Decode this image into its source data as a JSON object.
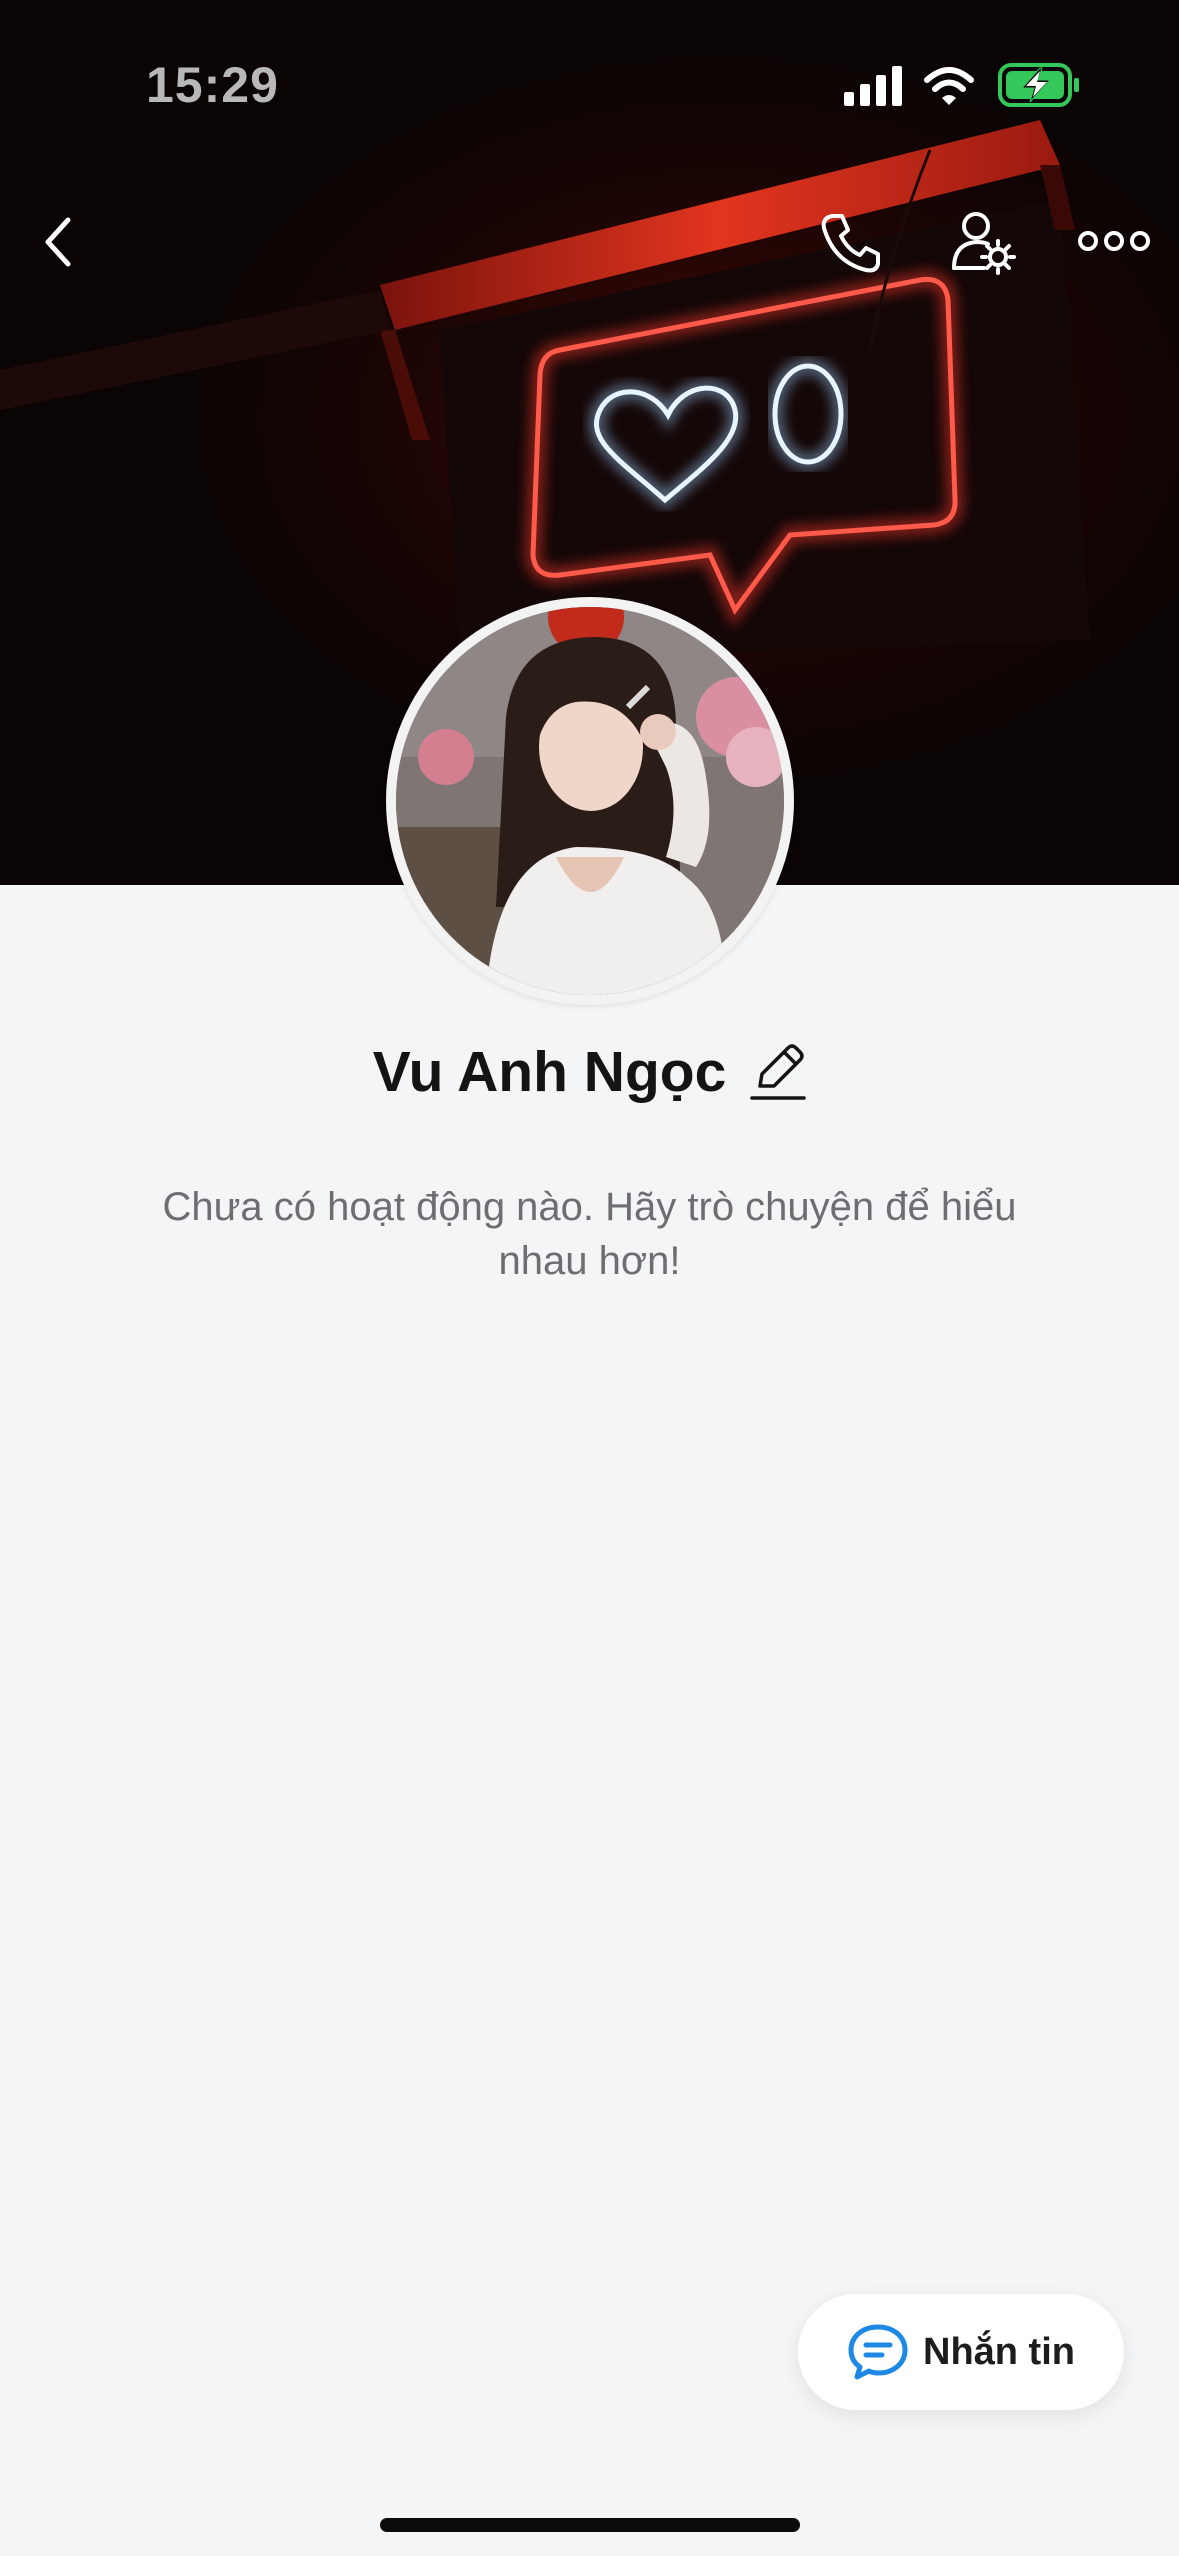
{
  "status_bar": {
    "time": "15:29",
    "icons": [
      "cellular-signal-icon",
      "wifi-icon",
      "battery-charging-icon"
    ]
  },
  "nav": {
    "back_icon": "chevron-left-icon",
    "call_icon": "phone-icon",
    "profile_settings_icon": "user-settings-icon",
    "more_icon": "more-dots-icon"
  },
  "cover": {
    "neon_zero": "0"
  },
  "profile": {
    "name": "Vu Anh Ngọc",
    "edit_icon": "pencil-icon",
    "empty_message": "Chưa có hoạt động nào. Hãy trò chuyện để hiểu nhau hơn!"
  },
  "actions": {
    "message_label": "Nhắn tin",
    "message_icon": "chat-bubble-icon"
  },
  "colors": {
    "accent": "#1e88e5",
    "background": "#f4f5f7",
    "neon_red": "#ff3b2f",
    "neon_blue": "#cfe8ff",
    "battery_green": "#34c759"
  }
}
